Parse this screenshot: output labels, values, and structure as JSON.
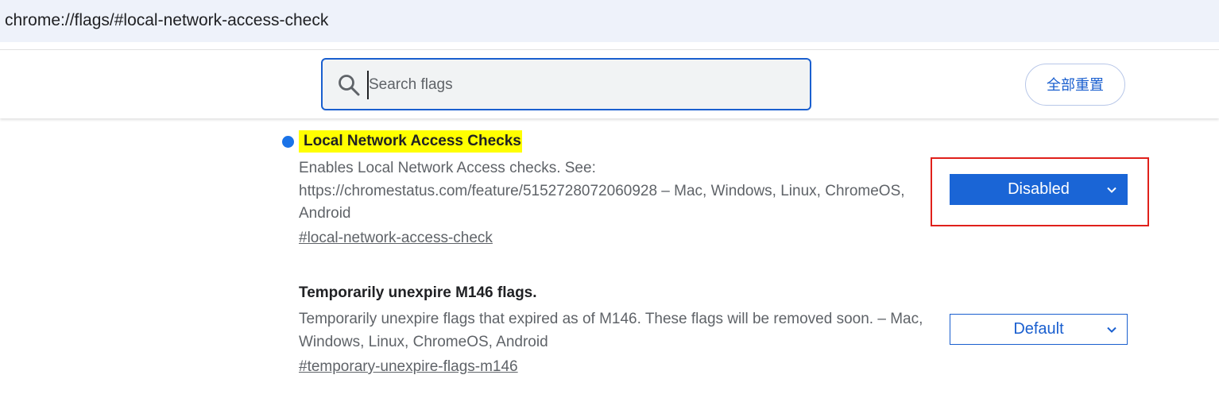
{
  "omnibox": {
    "url_scheme": "chrome://",
    "url_host": "flags",
    "url_rest": "/#local-network-access-check"
  },
  "header": {
    "search_placeholder": "Search flags",
    "reset_all_label": "全部重置"
  },
  "flags": [
    {
      "title": "Local Network Access Checks",
      "description": "Enables Local Network Access checks. See: https://chromestatus.com/feature/5152728072060928 – Mac, Windows, Linux, ChromeOS, Android",
      "link": "#local-network-access-check",
      "state": "Disabled",
      "highlighted": true
    },
    {
      "title": "Temporarily unexpire M146 flags.",
      "description": "Temporarily unexpire flags that expired as of M146. These flags will be removed soon. – Mac, Windows, Linux, ChromeOS, Android",
      "link": "#temporary-unexpire-flags-m146",
      "state": "Default",
      "highlighted": false
    }
  ],
  "colors": {
    "accent": "#1a5fcf",
    "highlight": "#ffff00",
    "annotation_box": "#e0201b",
    "modified_dot": "#1a73e8"
  }
}
